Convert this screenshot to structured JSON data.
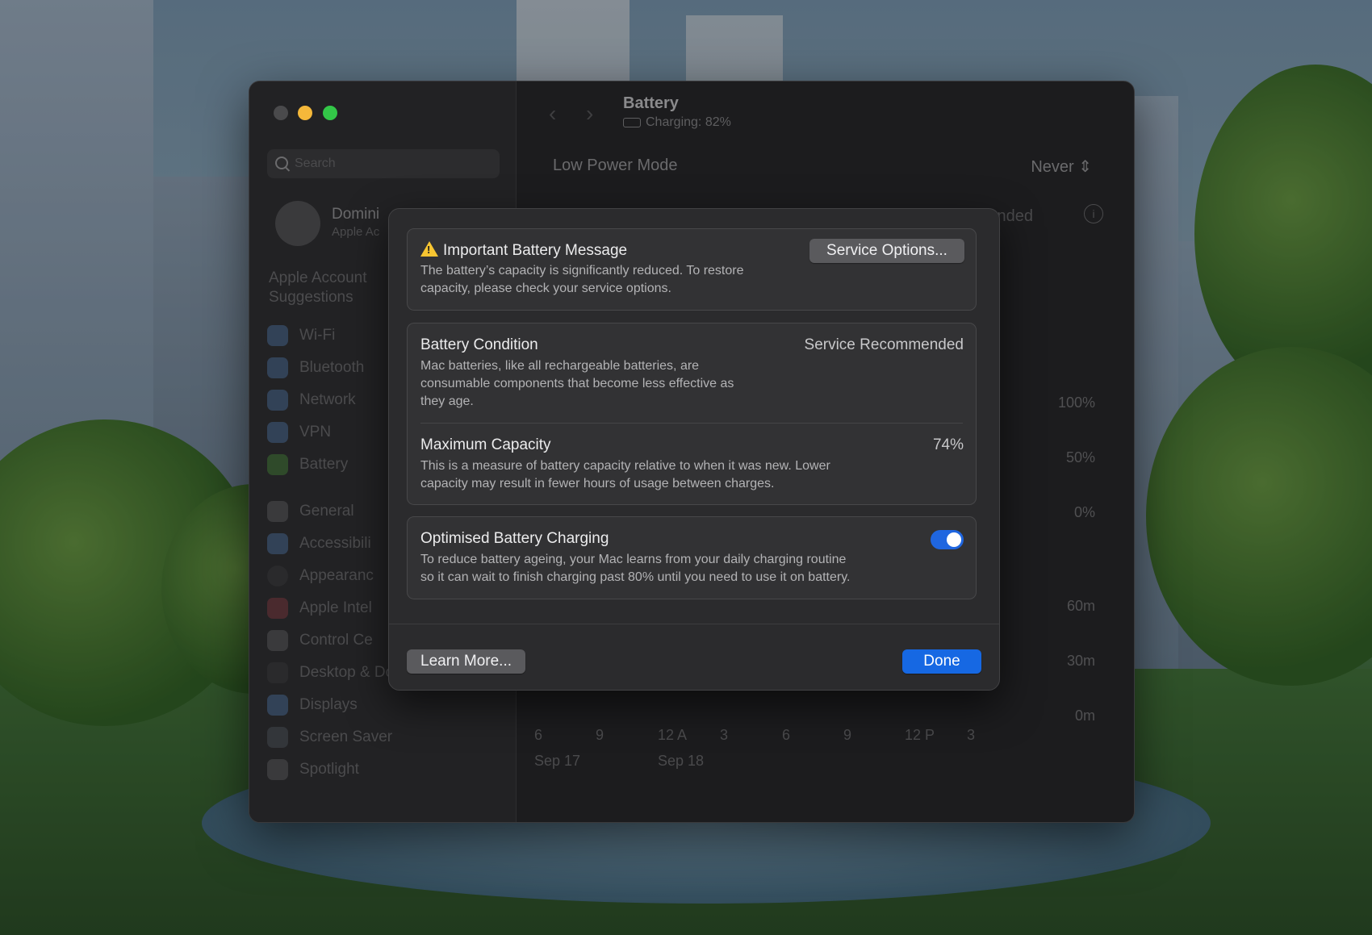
{
  "window": {
    "sidebar": {
      "search_placeholder": "Search",
      "account_name": "Domini",
      "account_sub": "Apple Ac",
      "suggestions": "Apple Account Suggestions",
      "items": [
        {
          "label": "Wi-Fi",
          "icon": "wifi-icon"
        },
        {
          "label": "Bluetooth",
          "icon": "bluetooth-icon"
        },
        {
          "label": "Network",
          "icon": "network-icon"
        },
        {
          "label": "VPN",
          "icon": "vpn-icon"
        },
        {
          "label": "Battery",
          "icon": "battery-icon"
        },
        {
          "label": "General",
          "icon": "gear-icon"
        },
        {
          "label": "Accessibili",
          "icon": "accessibility-icon"
        },
        {
          "label": "Appearanc",
          "icon": "appearance-icon"
        },
        {
          "label": "Apple Intel",
          "icon": "apple-intelligence-icon"
        },
        {
          "label": "Control Ce",
          "icon": "control-centre-icon"
        },
        {
          "label": "Desktop & Dock",
          "icon": "dock-icon"
        },
        {
          "label": "Displays",
          "icon": "displays-icon"
        },
        {
          "label": "Screen Saver",
          "icon": "screen-saver-icon"
        },
        {
          "label": "Spotlight",
          "icon": "spotlight-icon"
        }
      ]
    },
    "main": {
      "title": "Battery",
      "subtitle": "Charging: 82%",
      "low_power_mode_label": "Low Power Mode",
      "low_power_mode_value": "Never",
      "health_peek": "mended",
      "chart_level_labels": [
        "100%",
        "50%",
        "0%"
      ],
      "chart_time_labels": [
        "60m",
        "30m",
        "0m"
      ],
      "x_labels": [
        "6",
        "9",
        "12 A",
        "3",
        "6",
        "9",
        "12 P",
        "3"
      ],
      "day_labels": [
        "Sep 17",
        "Sep 18"
      ]
    }
  },
  "dialog": {
    "message": {
      "title": "Important Battery Message",
      "description_line1": "The battery’s capacity is significantly reduced. To restore",
      "description_line2": "capacity, please check your service options.",
      "service_button": "Service Options..."
    },
    "condition": {
      "title": "Battery Condition",
      "value": "Service Recommended",
      "description_line1": "Mac batteries, like all rechargeable batteries, are",
      "description_line2": "consumable components that become less effective as",
      "description_line3": "they age."
    },
    "capacity": {
      "title": "Maximum Capacity",
      "value": "74%",
      "description_line1": "This is a measure of battery capacity relative to when it was new. Lower",
      "description_line2": "capacity may result in fewer hours of usage between charges."
    },
    "optimised": {
      "title": "Optimised Battery Charging",
      "enabled": true,
      "description_line1": "To reduce battery ageing, your Mac learns from your daily charging routine",
      "description_line2": "so it can wait to finish charging past 80% until you need to use it on battery."
    },
    "learn_more_button": "Learn More...",
    "done_button": "Done"
  },
  "colors": {
    "accent": "#1668e3",
    "warning": "#f7c531",
    "dialog_background": "#2b2b2d"
  }
}
